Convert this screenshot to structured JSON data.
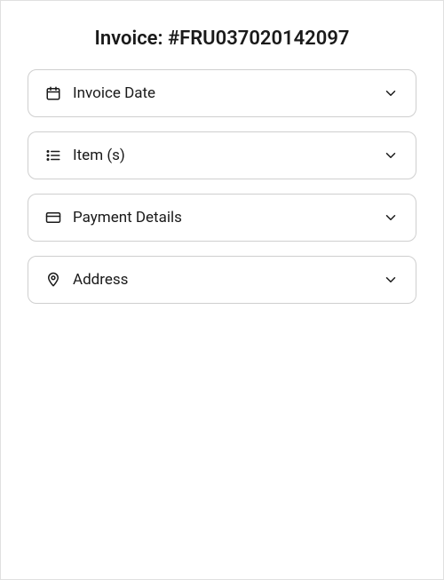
{
  "header": {
    "title": "Invoice: #FRU037020142097"
  },
  "sections": {
    "invoice_date": {
      "label": "Invoice Date",
      "icon": "calendar-icon"
    },
    "items": {
      "label": "Item (s)",
      "icon": "list-icon"
    },
    "payment": {
      "label": "Payment Details",
      "icon": "credit-card-icon"
    },
    "address": {
      "label": "Address",
      "icon": "map-pin-icon"
    }
  }
}
